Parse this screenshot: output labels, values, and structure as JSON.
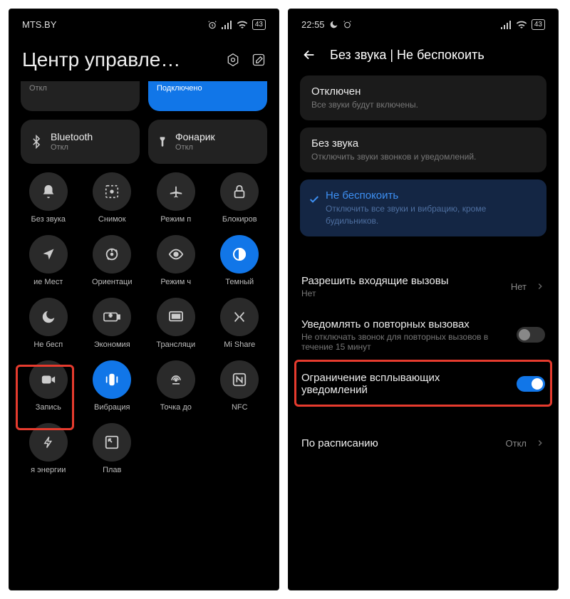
{
  "left": {
    "carrier": "MTS.BY",
    "battery": "43",
    "title": "Центр управле…",
    "tiles": [
      {
        "label": "",
        "sub": "Откл"
      },
      {
        "label": "",
        "sub": "Подключено",
        "active": true
      },
      {
        "label": "Bluetooth",
        "sub": "Откл"
      },
      {
        "label": "Фонарик",
        "sub": "Откл"
      }
    ],
    "toggles": [
      {
        "label": "Без звука",
        "icon": "bell"
      },
      {
        "label": "Снимок",
        "icon": "scissors"
      },
      {
        "label": "Режим п",
        "icon": "airplane"
      },
      {
        "label": "Блокиров",
        "icon": "lock"
      },
      {
        "label": "ие   Мест",
        "icon": "location"
      },
      {
        "label": "Ориентаци",
        "icon": "orientation"
      },
      {
        "label": "Режим ч",
        "icon": "eye"
      },
      {
        "label": "Темный",
        "icon": "darkmode",
        "active": true
      },
      {
        "label": "Не бесп",
        "icon": "moon"
      },
      {
        "label": "Экономия",
        "icon": "battery"
      },
      {
        "label": "Трансляци",
        "icon": "cast"
      },
      {
        "label": "Mi Share",
        "icon": "mishare"
      },
      {
        "label": "Запись",
        "icon": "record"
      },
      {
        "label": "Вибрация",
        "icon": "vibrate",
        "active": true
      },
      {
        "label": "Точка до",
        "icon": "hotspot"
      },
      {
        "label": "NFC",
        "icon": "nfc"
      },
      {
        "label": "я энергии",
        "icon": "bolt"
      },
      {
        "label": "Плав",
        "icon": "pip"
      }
    ]
  },
  "right": {
    "time": "22:55",
    "battery": "43",
    "header": "Без звука | Не беспокоить",
    "options": [
      {
        "title": "Отключен",
        "sub": "Все звуки будут включены."
      },
      {
        "title": "Без звука",
        "sub": "Отключить звуки звонков и уведомлений."
      },
      {
        "title": "Не беспокоить",
        "sub": "Отключить все звуки и вибрацию, кроме будильников.",
        "selected": true
      }
    ],
    "rows": {
      "allow_calls": {
        "title": "Разрешить входящие вызовы",
        "sub": "Нет",
        "value": "Нет"
      },
      "repeat": {
        "title": "Уведомлять о повторных вызовах",
        "sub": "Не отключать звонок для повторных вызовов в течение 15 минут"
      },
      "popup": {
        "title": "Ограничение всплывающих уведомлений"
      },
      "schedule": {
        "title": "По расписанию",
        "value": "Откл"
      }
    }
  }
}
